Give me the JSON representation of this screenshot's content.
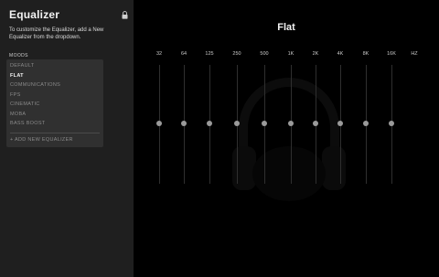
{
  "panel": {
    "title": "Equalizer",
    "description": "To customize the Equalizer, add a New Equalizer from the dropdown.",
    "moods_label": "MOODS",
    "lock_icon": "lock-icon",
    "presets": [
      "DEFAULT",
      "FLAT",
      "COMMUNICATIONS",
      "FPS",
      "CINEMATIC",
      "MOBA",
      "BASS BOOST"
    ],
    "selected_preset": "FLAT",
    "add_label": "+ ADD NEW EQUALIZER"
  },
  "main": {
    "title": "Flat",
    "bands": [
      {
        "label": "32",
        "gain": 0
      },
      {
        "label": "64",
        "gain": 0
      },
      {
        "label": "125",
        "gain": 0
      },
      {
        "label": "250",
        "gain": 0
      },
      {
        "label": "500",
        "gain": 0
      },
      {
        "label": "1K",
        "gain": 0
      },
      {
        "label": "2K",
        "gain": 0
      },
      {
        "label": "4K",
        "gain": 0
      },
      {
        "label": "8K",
        "gain": 0
      },
      {
        "label": "16K",
        "gain": 0
      }
    ],
    "unit_label": "HZ",
    "background_icon": "headphones-icon"
  },
  "colors": {
    "panel_bg": "#1f1f1f",
    "dropdown_bg": "#303030",
    "main_bg": "#000000",
    "knob": "#9a9a9a"
  }
}
